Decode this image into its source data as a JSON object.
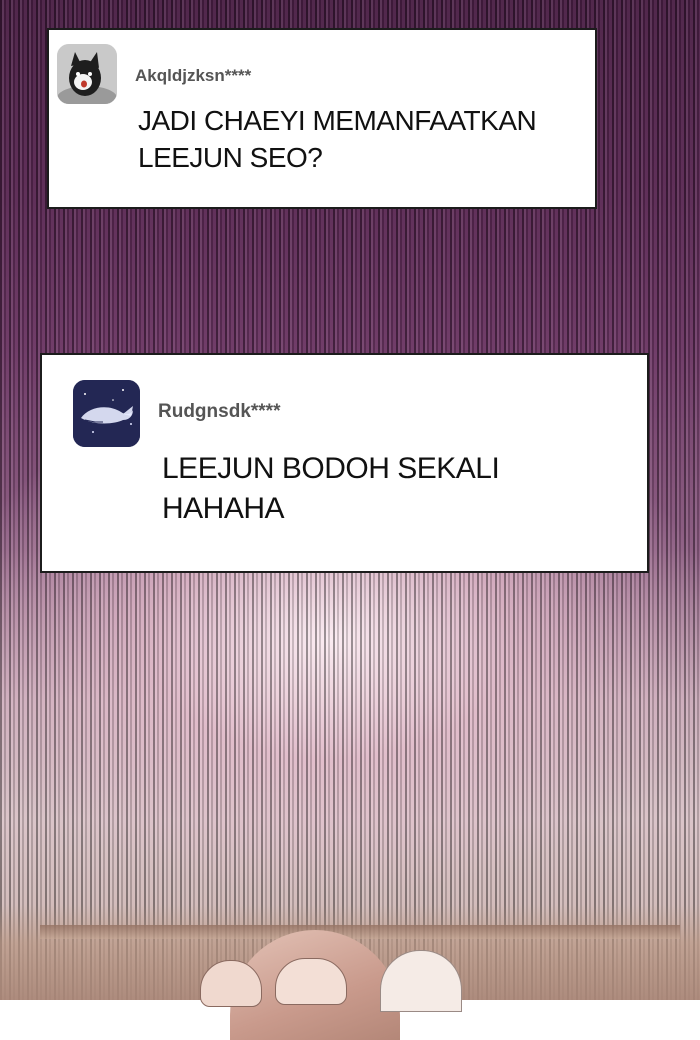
{
  "comments": [
    {
      "username": "Akqldjzksn****",
      "avatar_icon": "cat-avatar-icon",
      "lines": [
        "JADI CHAEYI MEMANFAATKAN",
        "LEEJUN SEO?"
      ]
    },
    {
      "username": "Rudgnsdk****",
      "avatar_icon": "whale-avatar-icon",
      "lines": [
        "LEEJUN BODOH SEKALI",
        "HAHAHA"
      ]
    }
  ],
  "colors": {
    "background_top": "#4a1f45",
    "background_bottom": "#c8b0a8",
    "card_bg": "#ffffff",
    "card_border": "#1c1c1c",
    "username": "#555555",
    "text": "#111111"
  }
}
